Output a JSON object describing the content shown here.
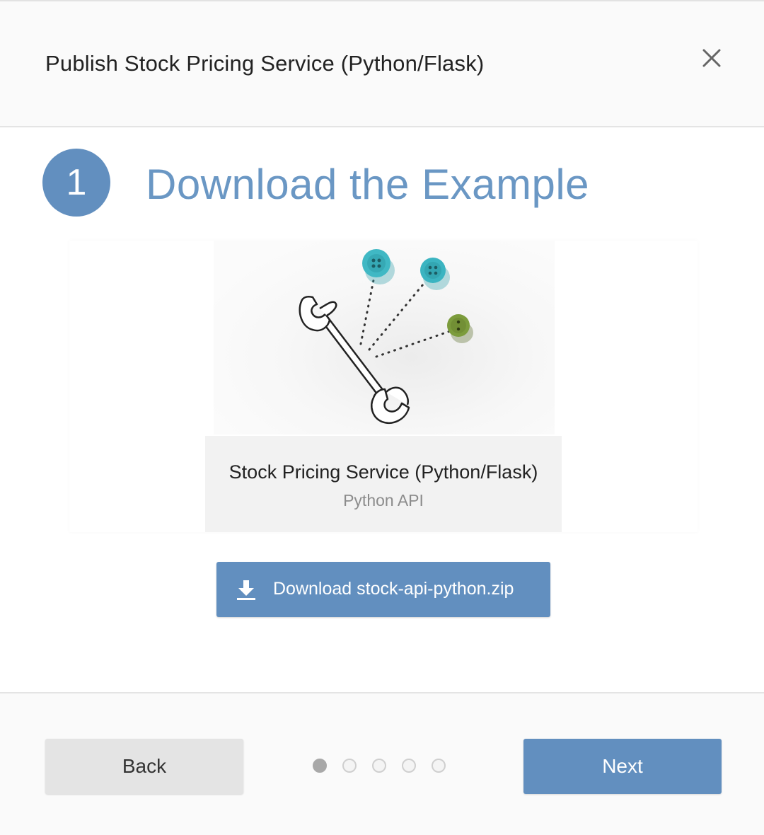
{
  "header": {
    "title": "Publish Stock Pricing Service (Python/Flask)",
    "close_icon": "close-icon"
  },
  "step": {
    "number": "1",
    "title": "Download the Example"
  },
  "card": {
    "illustration": "wrench-buttons-illustration",
    "name": "Stock Pricing Service (Python/Flask)",
    "type": "Python API"
  },
  "download": {
    "icon": "download-icon",
    "label": "Download stock-api-python.zip"
  },
  "footer": {
    "back_label": "Back",
    "next_label": "Next",
    "pager": {
      "total": 5,
      "current": 1
    }
  },
  "colors": {
    "accent": "#628fbf",
    "step_title": "#6a97c4",
    "button_teal": "#3fb5c2",
    "button_green": "#7a9a3a"
  }
}
